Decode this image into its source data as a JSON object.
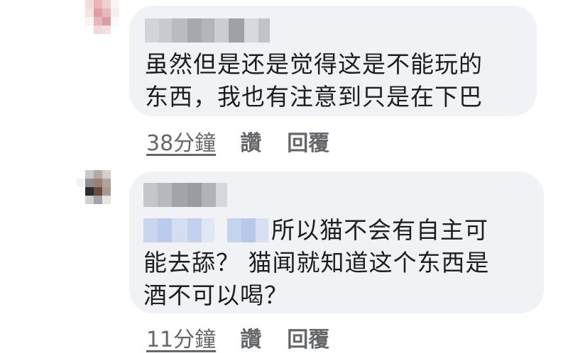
{
  "comments": [
    {
      "text_lines": [
        "虽然但是还是觉得这是不能玩的",
        "东西，我也有注意到只是在下巴"
      ],
      "time": "38分鐘",
      "like": "讚",
      "reply": "回覆"
    },
    {
      "text_lines": [
        "所以猫不会有自主可",
        "能去舔？ 猫闻就知道这个东西是",
        "酒不可以喝？"
      ],
      "time": "11分鐘",
      "like": "讚",
      "reply": "回覆"
    }
  ]
}
